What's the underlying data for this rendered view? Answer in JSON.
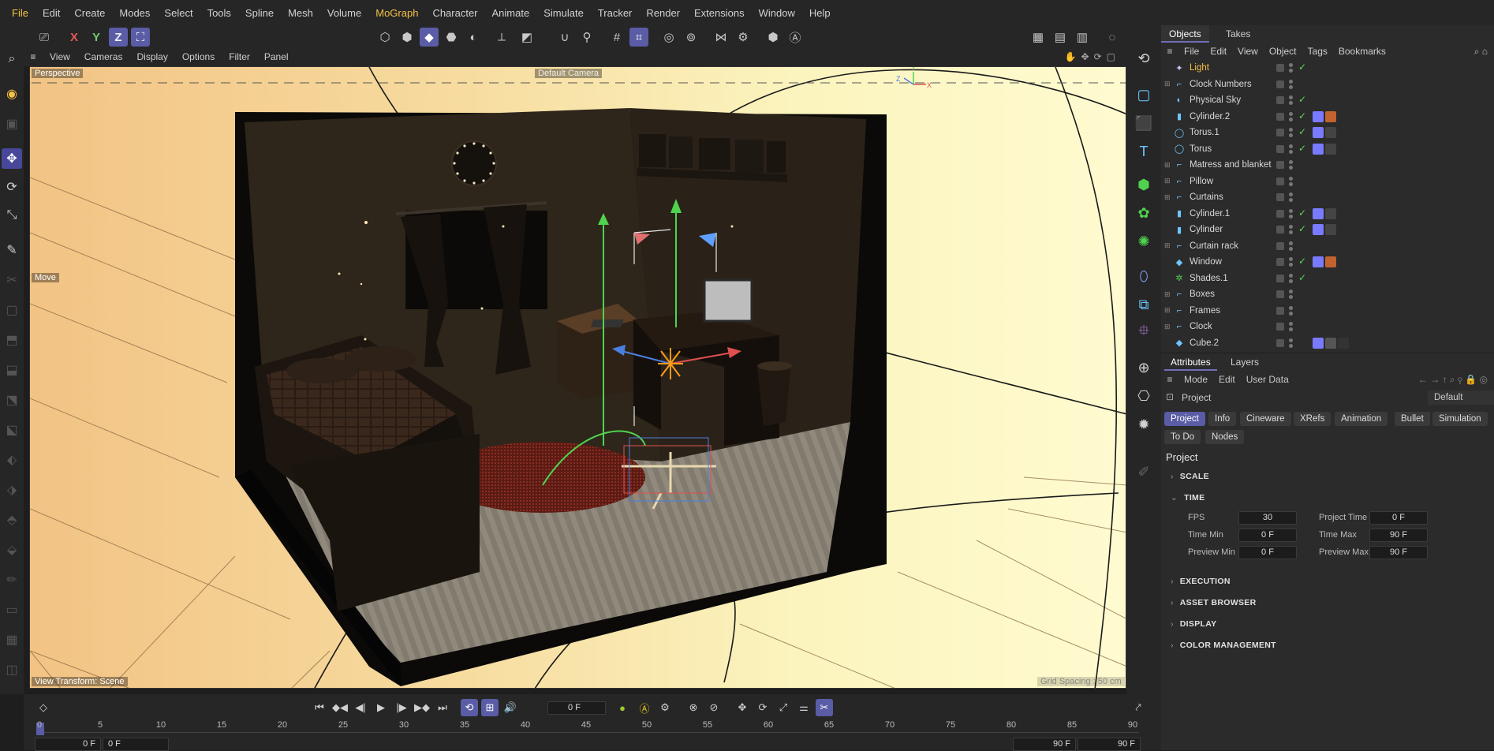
{
  "menu": [
    "File",
    "Edit",
    "Create",
    "Modes",
    "Select",
    "Tools",
    "Spline",
    "Mesh",
    "Volume",
    "MoGraph",
    "Character",
    "Animate",
    "Simulate",
    "Tracker",
    "Render",
    "Extensions",
    "Window",
    "Help"
  ],
  "toolbar": {
    "x": "X",
    "y": "Y",
    "z": "Z"
  },
  "viewport": {
    "menu": [
      "View",
      "Cameras",
      "Display",
      "Options",
      "Filter",
      "Panel"
    ],
    "label": "Perspective",
    "camera": "Default Camera",
    "tool_hint": "Move",
    "view_transform": "View Transform: Scene",
    "grid_spacing": "Grid Spacing : 50 cm"
  },
  "objects_panel": {
    "tabs": [
      "Objects",
      "Takes"
    ],
    "menu": [
      "File",
      "Edit",
      "View",
      "Object",
      "Tags",
      "Bookmarks"
    ],
    "items": [
      {
        "name": "Light",
        "icon": "light-icon",
        "highlight": true,
        "tick": true,
        "tags": []
      },
      {
        "name": "Clock Numbers",
        "icon": "null-icon",
        "highlight": false,
        "tick": false,
        "tags": []
      },
      {
        "name": "Physical Sky",
        "icon": "sky-icon",
        "highlight": false,
        "tick": true,
        "tags": []
      },
      {
        "name": "Cylinder.2",
        "icon": "cylinder-icon",
        "highlight": false,
        "tick": true,
        "tags": [
          "#7a7aff",
          "#c0632f"
        ]
      },
      {
        "name": "Torus.1",
        "icon": "torus-icon",
        "highlight": false,
        "tick": true,
        "tags": [
          "#7a7aff",
          "#444"
        ]
      },
      {
        "name": "Torus",
        "icon": "torus-icon",
        "highlight": false,
        "tick": true,
        "tags": [
          "#7a7aff",
          "#444"
        ]
      },
      {
        "name": "Matress and blanket",
        "icon": "null-icon",
        "highlight": false,
        "tick": false,
        "tags": []
      },
      {
        "name": "Pillow",
        "icon": "null-icon",
        "highlight": false,
        "tick": false,
        "tags": []
      },
      {
        "name": "Curtains",
        "icon": "null-icon",
        "highlight": false,
        "tick": false,
        "tags": []
      },
      {
        "name": "Cylinder.1",
        "icon": "cylinder-icon",
        "highlight": false,
        "tick": true,
        "tags": [
          "#7a7aff",
          "#444"
        ]
      },
      {
        "name": "Cylinder",
        "icon": "cylinder-icon",
        "highlight": false,
        "tick": true,
        "tags": [
          "#7a7aff",
          "#444"
        ]
      },
      {
        "name": "Curtain rack",
        "icon": "null-icon",
        "highlight": false,
        "tick": false,
        "tags": []
      },
      {
        "name": "Window",
        "icon": "cube-icon",
        "highlight": false,
        "tick": true,
        "tags": [
          "#7a7aff",
          "#c0632f"
        ]
      },
      {
        "name": "Shades.1",
        "icon": "cloner-icon",
        "highlight": false,
        "tick": true,
        "tags": []
      },
      {
        "name": "Boxes",
        "icon": "null-icon",
        "highlight": false,
        "tick": false,
        "tags": []
      },
      {
        "name": "Frames",
        "icon": "null-icon",
        "highlight": false,
        "tick": false,
        "tags": []
      },
      {
        "name": "Clock",
        "icon": "null-icon",
        "highlight": false,
        "tick": false,
        "tags": []
      },
      {
        "name": "Cube.2",
        "icon": "cube-icon",
        "highlight": false,
        "tick": false,
        "tags": [
          "#7a7aff",
          "#555",
          "#333"
        ]
      }
    ]
  },
  "attributes": {
    "tabs": [
      "Attributes",
      "Layers"
    ],
    "menu": [
      "Mode",
      "Edit",
      "User Data"
    ],
    "object_label": "Project",
    "preset": "Default",
    "sub_tabs": [
      "Project",
      "Info",
      "Cineware",
      "XRefs",
      "Animation",
      "Bullet",
      "Simulation",
      "To Do",
      "Nodes"
    ],
    "heading": "Project",
    "sections": [
      "SCALE",
      "TIME",
      "EXECUTION",
      "ASSET BROWSER",
      "DISPLAY",
      "COLOR MANAGEMENT"
    ],
    "time": {
      "fps_label": "FPS",
      "fps": "30",
      "project_time_label": "Project Time",
      "project_time": "0 F",
      "time_min_label": "Time Min",
      "time_min": "0 F",
      "time_max_label": "Time Max",
      "time_max": "90 F",
      "preview_min_label": "Preview Min",
      "preview_min": "0 F",
      "preview_max_label": "Preview Max",
      "preview_max": "90 F"
    }
  },
  "timeline": {
    "current_frame": "0 F",
    "ticks": [
      "0",
      "5",
      "10",
      "15",
      "20",
      "25",
      "30",
      "35",
      "40",
      "45",
      "50",
      "55",
      "60",
      "65",
      "70",
      "75",
      "80",
      "85",
      "90"
    ],
    "start_a": "0 F",
    "start_b": "0 F",
    "end_a": "90 F",
    "end_b": "90 F"
  }
}
